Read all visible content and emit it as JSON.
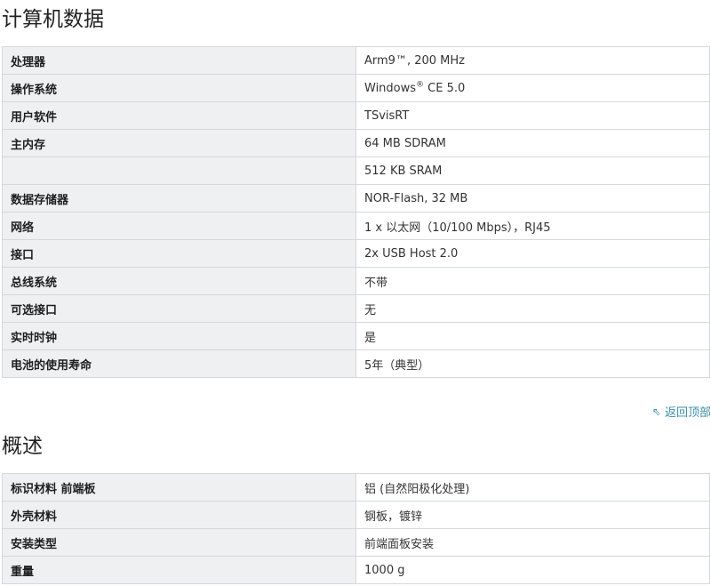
{
  "sections": [
    {
      "title": "计算机数据",
      "rows": [
        {
          "label": "处理器",
          "value": "Arm9™, 200 MHz"
        },
        {
          "label": "操作系统",
          "value_pre": "Windows",
          "value_sup": "®",
          "value_post": " CE 5.0"
        },
        {
          "label": "用户软件",
          "value": "TSvisRT"
        },
        {
          "label": "主内存",
          "value": "64 MB SDRAM"
        },
        {
          "label": "",
          "value": "512 KB SRAM"
        },
        {
          "label": "数据存储器",
          "value": "NOR-Flash, 32 MB"
        },
        {
          "label": "网络",
          "value": "1 x 以太网（10/100 Mbps），RJ45"
        },
        {
          "label": "接口",
          "value": "2x USB Host 2.0"
        },
        {
          "label": "总线系统",
          "value": "不带"
        },
        {
          "label": "可选接口",
          "value": "无"
        },
        {
          "label": "实时时钟",
          "value": "是"
        },
        {
          "label": "电池的使用寿命",
          "value": "5年（典型）"
        }
      ]
    },
    {
      "title": "概述",
      "rows": [
        {
          "label": "标识材料 前端板",
          "value": "铝 (自然阳极化处理)"
        },
        {
          "label": "外壳材料",
          "value": "钢板，镀锌"
        },
        {
          "label": "安装类型",
          "value": "前端面板安装"
        },
        {
          "label": "重量",
          "value": "1000 g"
        }
      ]
    }
  ],
  "back_to_top": {
    "label": "返回顶部",
    "icon": "arrow-up-left-icon"
  }
}
